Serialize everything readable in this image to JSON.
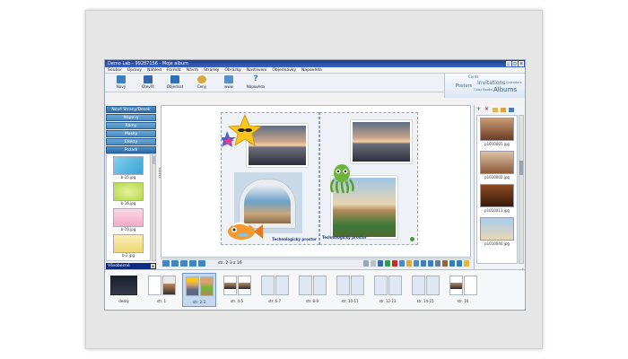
{
  "window": {
    "title": "Demo Lab - 99287156 - Moje album",
    "controls": [
      "_",
      "□",
      "×"
    ]
  },
  "menu": [
    "Soubor",
    "Úpravy",
    "Náhled",
    "Formát",
    "Návrh",
    "Stránky",
    "Obrázky",
    "Nastavení",
    "Objednávky",
    "Nápověda"
  ],
  "toolbar": [
    {
      "label": "Nový",
      "icon": "new-album-icon",
      "color": "#3d7fc0"
    },
    {
      "label": "Otevřít",
      "icon": "open-folder-icon",
      "color": "#3567a8"
    },
    {
      "label": "Objednat",
      "icon": "cart-icon",
      "color": "#2f6fb4"
    },
    {
      "label": "Ceny",
      "icon": "coins-icon",
      "color": "#d9a83a"
    },
    {
      "label": "www",
      "icon": "web-icon",
      "color": "#5a8fc8"
    },
    {
      "label": "Nápověda",
      "icon": "help-icon",
      "color": "#3a76b8"
    }
  ],
  "brand": {
    "cards": "Cards",
    "invitations": "Invitations",
    "calendars": "Calendars",
    "posters": "Posters",
    "color_books": "Color Books",
    "albums": "Albums"
  },
  "left_panel": {
    "categories": [
      "Nové Strany/Desek",
      "Nápovy",
      "Rámy",
      "Masky",
      "Efekty",
      "Pozadí"
    ],
    "thumbs": [
      {
        "label": "b-15.jpg",
        "color": "#6ec3e6"
      },
      {
        "label": "b-16.jpg",
        "color": "#c9e26a"
      },
      {
        "label": "b-19.jpg",
        "color": "#f6c2d6"
      },
      {
        "label": "b-2.jpg",
        "color": "#f3e59a"
      }
    ],
    "select_value": "Všeobecné"
  },
  "canvas": {
    "footer_left": "Technologický prostor",
    "footer_right": "Technologický prostor"
  },
  "navbar": {
    "page_label": "str. 2-3 z 16"
  },
  "right_panel": {
    "photos": [
      {
        "label": "p1010001.jpg",
        "color": "#8a5a3a"
      },
      {
        "label": "p1010002.jpg",
        "color": "#a07052"
      },
      {
        "label": "p1010013.jpg",
        "color": "#6a3a1a"
      },
      {
        "label": "p1010040.jpg",
        "color": "#7ea9d4"
      }
    ]
  },
  "filmstrip": [
    {
      "label": "desky"
    },
    {
      "label": "str. 1"
    },
    {
      "label": "str. 2-3",
      "selected": true
    },
    {
      "label": "str. 4-5"
    },
    {
      "label": "str. 6-7"
    },
    {
      "label": "str. 8-9"
    },
    {
      "label": "str. 10-11"
    },
    {
      "label": "str. 12-13"
    },
    {
      "label": "str. 14-15"
    },
    {
      "label": "str. 16"
    }
  ]
}
